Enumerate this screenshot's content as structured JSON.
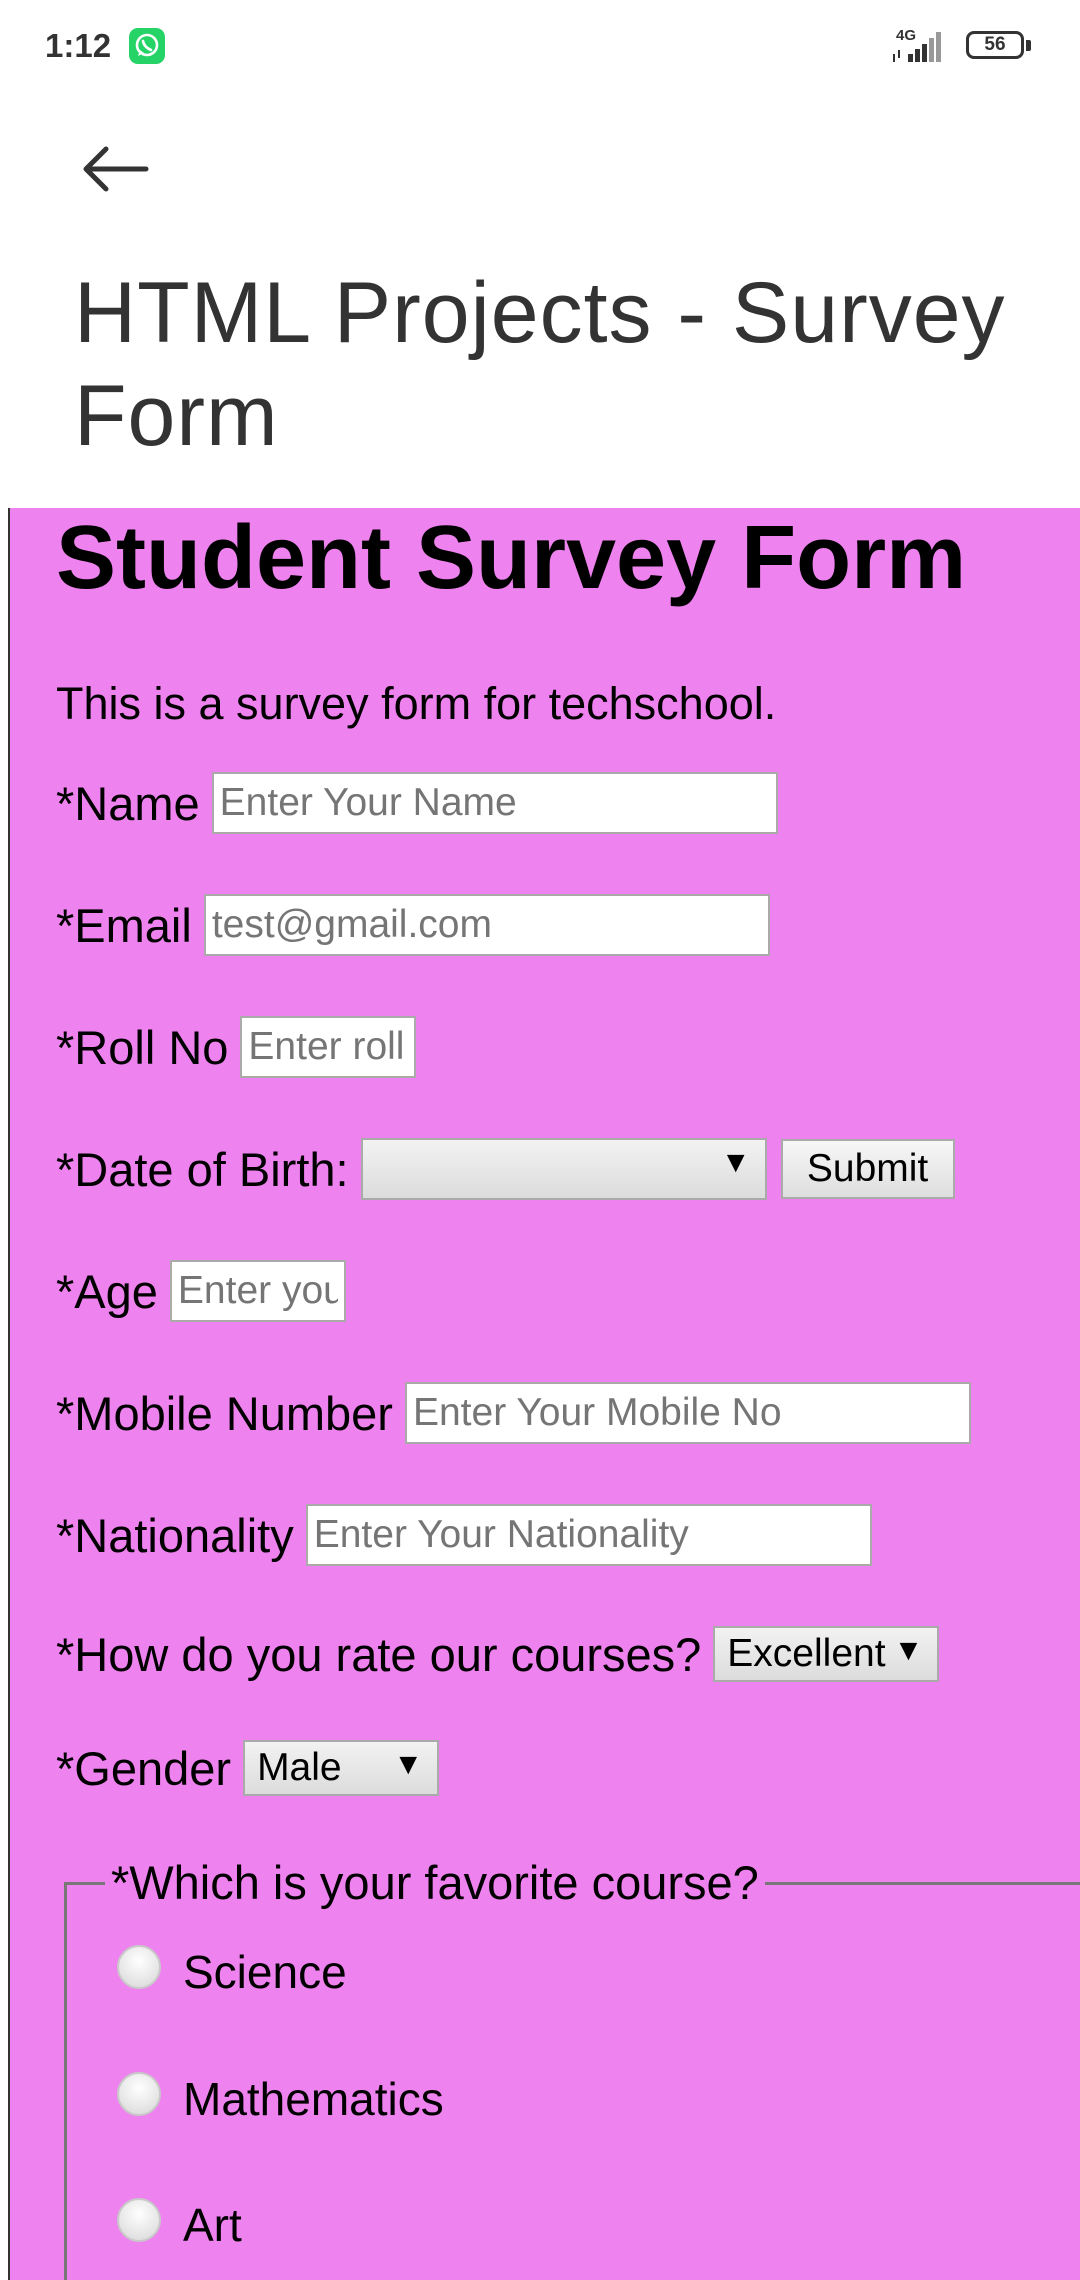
{
  "status_bar": {
    "time": "1:12",
    "network": "4G",
    "battery": "56",
    "icons": [
      "whatsapp-icon",
      "signal-icon",
      "battery-icon"
    ]
  },
  "app": {
    "title": "HTML Projects - Survey Form",
    "back_icon": "arrow-left-icon"
  },
  "form": {
    "background": "#EE82EE",
    "heading": "Student Survey Form",
    "description": "This is a survey form for techschool.",
    "name": {
      "label": "*Name",
      "placeholder": "Enter Your Name"
    },
    "email": {
      "label": "*Email",
      "placeholder": "test@gmail.com"
    },
    "roll": {
      "label": "*Roll No",
      "placeholder": "Enter roll"
    },
    "dob": {
      "label": "*Date of Birth:",
      "value": "",
      "submit_label": "Submit"
    },
    "age": {
      "label": "*Age",
      "placeholder": "Enter you"
    },
    "mobile": {
      "label": "*Mobile Number",
      "placeholder": "Enter Your Mobile No"
    },
    "nationality": {
      "label": "*Nationality",
      "placeholder": "Enter Your Nationality"
    },
    "rating": {
      "label": "*How do you rate our courses?",
      "value": "Excellent"
    },
    "gender": {
      "label": "*Gender",
      "value": "Male"
    },
    "favorite_course": {
      "legend": "*Which is your favorite course?",
      "options": [
        "Science",
        "Mathematics",
        "Art"
      ]
    }
  }
}
